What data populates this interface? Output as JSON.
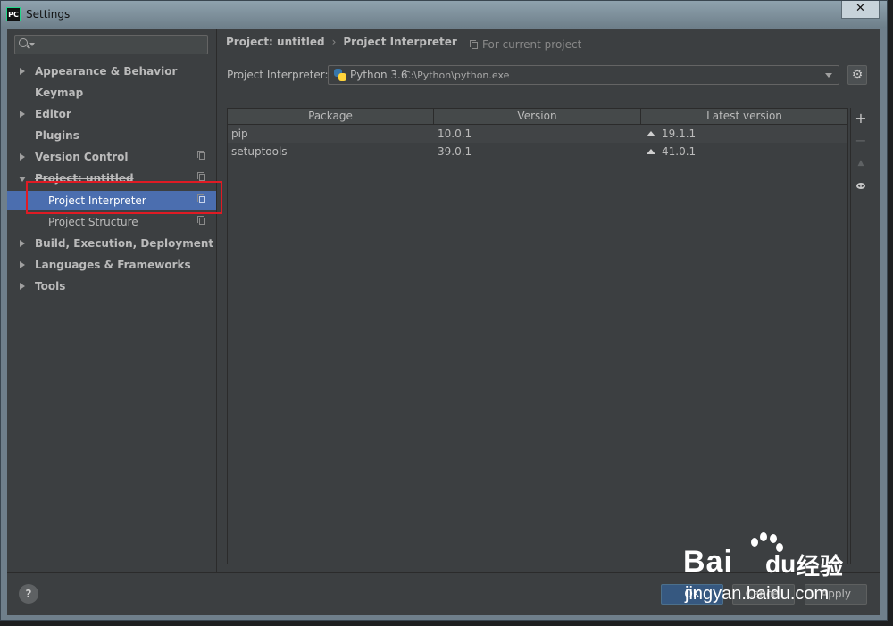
{
  "window": {
    "title": "Settings",
    "app_icon": "PC",
    "close_glyph": "✕"
  },
  "search": {
    "placeholder": ""
  },
  "sidebar": {
    "items": [
      {
        "label": "Appearance & Behavior",
        "expandable": true
      },
      {
        "label": "Keymap",
        "expandable": false
      },
      {
        "label": "Editor",
        "expandable": true
      },
      {
        "label": "Plugins",
        "expandable": false
      },
      {
        "label": "Version Control",
        "expandable": true,
        "icon": "copy-icon"
      },
      {
        "label": "Project: untitled",
        "expandable": true,
        "expanded": true,
        "icon": "copy-icon"
      },
      {
        "label": "Project Interpreter",
        "child": true,
        "selected": true,
        "icon": "copy-icon"
      },
      {
        "label": "Project Structure",
        "child": true,
        "icon": "copy-icon"
      },
      {
        "label": "Build, Execution, Deployment",
        "expandable": true
      },
      {
        "label": "Languages & Frameworks",
        "expandable": true
      },
      {
        "label": "Tools",
        "expandable": true
      }
    ]
  },
  "breadcrumb": {
    "parent": "Project: untitled",
    "separator": "›",
    "current": "Project Interpreter"
  },
  "scope_note": "For current project",
  "interpreter": {
    "label": "Project Interpreter:",
    "name": "Python 3.6",
    "path": "C:\\Python\\python.exe"
  },
  "packages_table": {
    "columns": [
      "Package",
      "Version",
      "Latest version"
    ],
    "rows": [
      {
        "package": "pip",
        "version": "10.0.1",
        "latest": "19.1.1"
      },
      {
        "package": "setuptools",
        "version": "39.0.1",
        "latest": "41.0.1"
      }
    ]
  },
  "side_tools": {
    "add": "+",
    "remove": "−",
    "upgrade": "▲"
  },
  "help": {
    "label": "?"
  },
  "buttons": {
    "ok": "OK",
    "cancel": "Cancel",
    "apply": "Apply"
  },
  "watermark": {
    "bai": "Bai",
    "du": "du",
    "jingyan": "经验",
    "url": "jingyan.baidu.com"
  },
  "colors": {
    "selection": "#4b6eaf",
    "highlight_box": "#e01b24",
    "background": "#3c3f41",
    "primary_button": "#365880"
  }
}
